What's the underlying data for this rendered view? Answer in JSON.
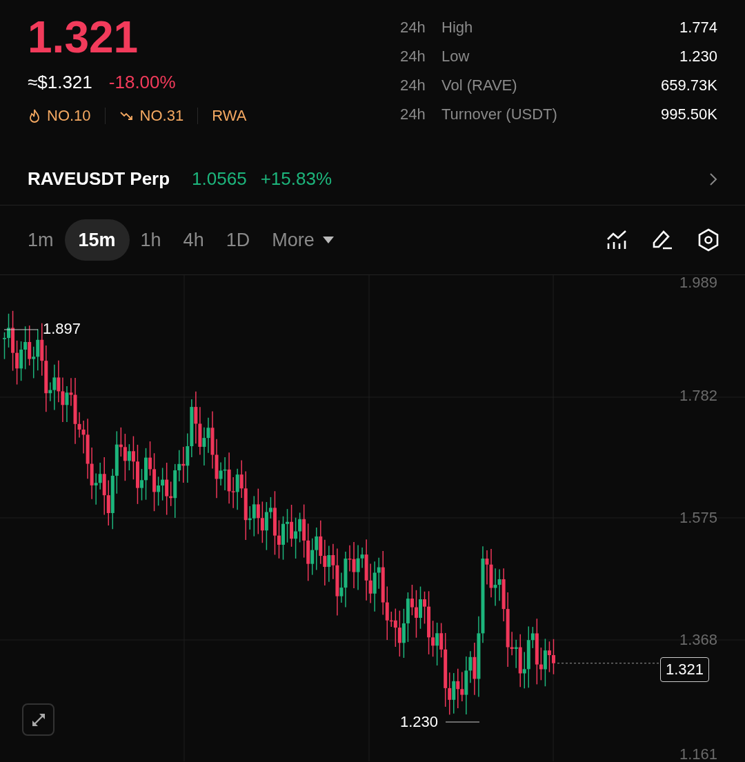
{
  "ticker": {
    "price": "1.321",
    "usd_price": "≈$1.321",
    "change": "-18.00%",
    "tags": [
      {
        "kind": "hot",
        "label": "NO.10"
      },
      {
        "kind": "falling",
        "label": "NO.31"
      },
      {
        "kind": "plain",
        "label": "RWA"
      }
    ]
  },
  "stats": [
    {
      "period": "24h",
      "label": "High",
      "value": "1.774"
    },
    {
      "period": "24h",
      "label": "Low",
      "value": "1.230"
    },
    {
      "period": "24h",
      "label": "Vol (RAVE)",
      "value": "659.73K"
    },
    {
      "period": "24h",
      "label": "Turnover (USDT)",
      "value": "995.50K"
    }
  ],
  "perp": {
    "name": "RAVEUSDT Perp",
    "price": "1.0565",
    "change": "+15.83%"
  },
  "intervals": [
    {
      "label": "1m",
      "selected": false
    },
    {
      "label": "15m",
      "selected": true
    },
    {
      "label": "1h",
      "selected": false
    },
    {
      "label": "4h",
      "selected": false
    },
    {
      "label": "1D",
      "selected": false
    }
  ],
  "more": {
    "label": "More"
  },
  "chart": {
    "y_axis": [
      "1.989",
      "1.782",
      "1.575",
      "1.368",
      "1.161"
    ],
    "high_marker": "1.897",
    "low_marker": "1.230",
    "last_price": "1.321"
  }
}
